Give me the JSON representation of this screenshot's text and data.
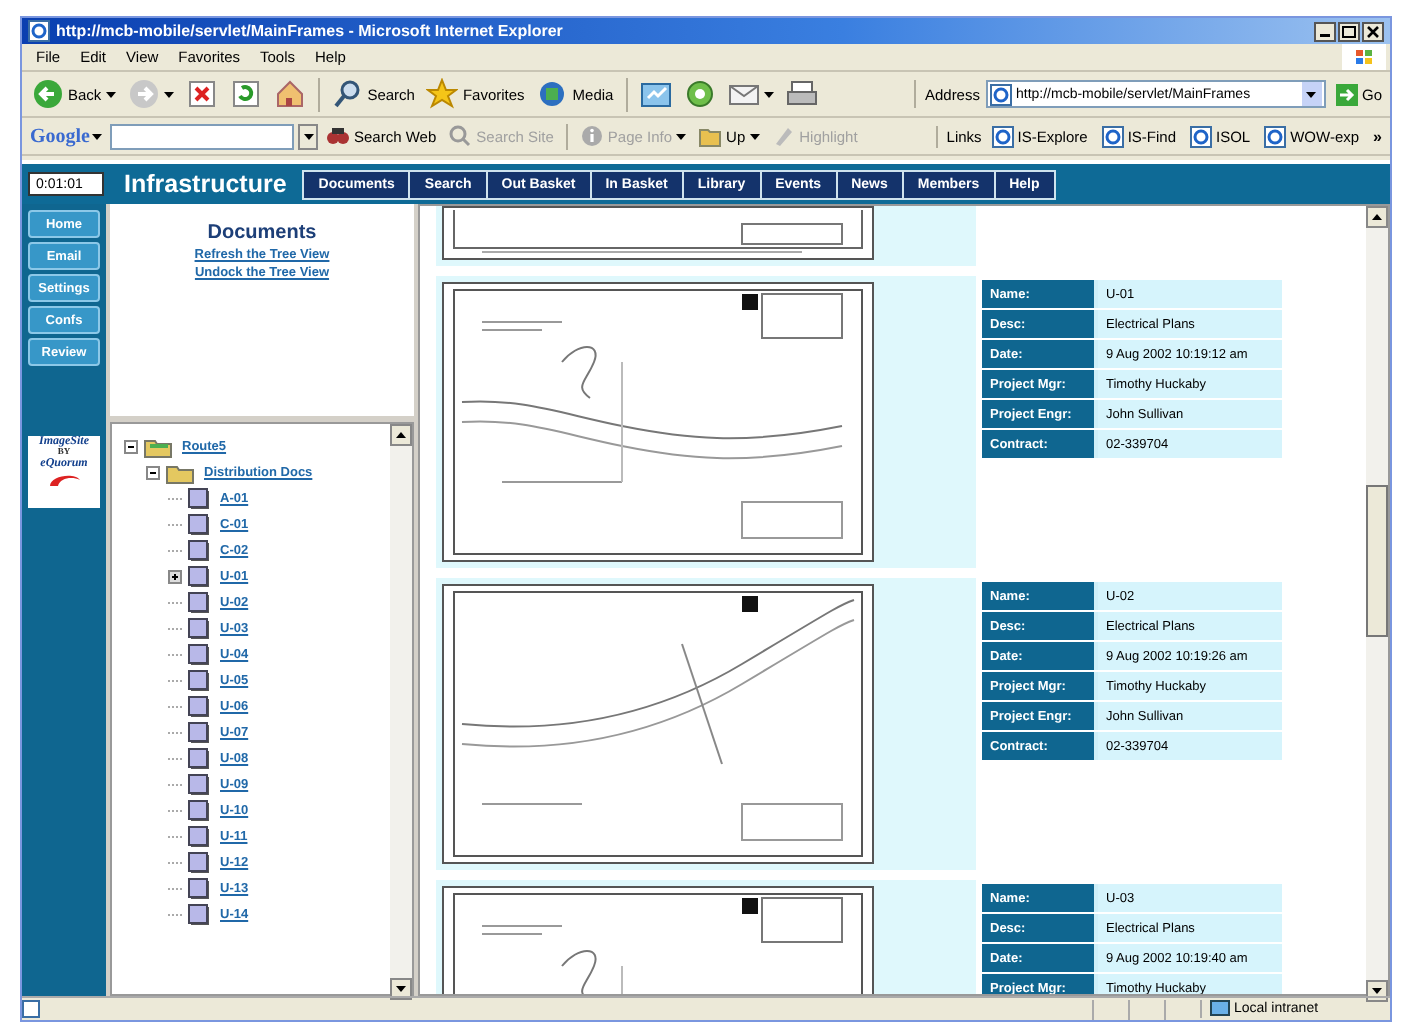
{
  "window": {
    "title": "http://mcb-mobile/servlet/MainFrames - Microsoft Internet Explorer"
  },
  "menu": [
    "File",
    "Edit",
    "View",
    "Favorites",
    "Tools",
    "Help"
  ],
  "toolbar": [
    {
      "kind": "back",
      "label": "Back"
    },
    {
      "kind": "forward"
    },
    {
      "kind": "stop"
    },
    {
      "kind": "refresh"
    },
    {
      "kind": "home"
    },
    {
      "kind": "search",
      "label": "Search"
    },
    {
      "kind": "favorites",
      "label": "Favorites"
    },
    {
      "kind": "media",
      "label": "Media"
    },
    {
      "kind": "history"
    },
    {
      "kind": "messenger"
    },
    {
      "kind": "mail"
    },
    {
      "kind": "print"
    }
  ],
  "address": {
    "label": "Address",
    "value": "http://mcb-mobile/servlet/MainFrames",
    "go": "Go"
  },
  "google_bar": {
    "logo": "Google",
    "items": [
      {
        "kind": "searchweb",
        "label": "Search Web",
        "disabled": false
      },
      {
        "kind": "searchsite",
        "label": "Search Site",
        "disabled": true
      },
      {
        "kind": "pageinfo",
        "label": "Page Info",
        "disabled": true
      },
      {
        "kind": "up",
        "label": "Up",
        "disabled": false
      },
      {
        "kind": "highlight",
        "label": "Highlight",
        "disabled": true
      }
    ]
  },
  "links": {
    "label": "Links",
    "items": [
      "IS-Explore",
      "IS-Find",
      "ISOL",
      "WOW-exp"
    ],
    "more": "»"
  },
  "site": {
    "timer": "0:01:01",
    "title": "Infrastructure",
    "tabs": [
      "Documents",
      "Search",
      "Out Basket",
      "In Basket",
      "Library",
      "Events",
      "News",
      "Members",
      "Help"
    ]
  },
  "side_nav": [
    "Home",
    "Email",
    "Settings",
    "Confs",
    "Review"
  ],
  "sponsor_logo": {
    "name": "ImageSite",
    "by": "BY",
    "company": "eQuorum"
  },
  "documents_panel": {
    "title": "Documents",
    "links": [
      "Refresh the Tree View",
      "Undock the Tree View"
    ]
  },
  "tree": [
    {
      "label": "Route5",
      "expanded": true,
      "children": [
        {
          "label": "Distribution Docs",
          "expanded": true,
          "children": [
            {
              "label": "A-01",
              "expandable": false
            },
            {
              "label": "C-01",
              "expandable": false
            },
            {
              "label": "C-02",
              "expandable": false
            },
            {
              "label": "U-01",
              "expandable": true
            },
            {
              "label": "U-02",
              "expandable": false
            },
            {
              "label": "U-03",
              "expandable": false
            },
            {
              "label": "U-04",
              "expandable": false
            },
            {
              "label": "U-05",
              "expandable": false
            },
            {
              "label": "U-06",
              "expandable": false
            },
            {
              "label": "U-07",
              "expandable": false
            },
            {
              "label": "U-08",
              "expandable": false
            },
            {
              "label": "U-09",
              "expandable": false
            },
            {
              "label": "U-10",
              "expandable": false
            },
            {
              "label": "U-11",
              "expandable": false
            },
            {
              "label": "U-12",
              "expandable": false
            },
            {
              "label": "U-13",
              "expandable": false
            },
            {
              "label": "U-14",
              "expandable": false
            }
          ]
        }
      ]
    }
  ],
  "documents": [
    {
      "fields": [
        {
          "label": "Name:",
          "value": "U-01"
        },
        {
          "label": "Desc:",
          "value": "Electrical Plans"
        },
        {
          "label": "Date:",
          "value": "9 Aug 2002 10:19:12 am"
        },
        {
          "label": "Project Mgr:",
          "value": "Timothy Huckaby"
        },
        {
          "label": "Project Engr:",
          "value": "John Sullivan"
        },
        {
          "label": "Contract:",
          "value": "02-339704"
        }
      ]
    },
    {
      "fields": [
        {
          "label": "Name:",
          "value": "U-02"
        },
        {
          "label": "Desc:",
          "value": "Electrical Plans"
        },
        {
          "label": "Date:",
          "value": "9 Aug 2002 10:19:26 am"
        },
        {
          "label": "Project Mgr:",
          "value": "Timothy Huckaby"
        },
        {
          "label": "Project Engr:",
          "value": "John Sullivan"
        },
        {
          "label": "Contract:",
          "value": "02-339704"
        }
      ]
    },
    {
      "fields": [
        {
          "label": "Name:",
          "value": "U-03"
        },
        {
          "label": "Desc:",
          "value": "Electrical Plans"
        },
        {
          "label": "Date:",
          "value": "9 Aug 2002 10:19:40 am"
        },
        {
          "label": "Project Mgr:",
          "value": "Timothy Huckaby"
        }
      ]
    }
  ],
  "status_bar": {
    "zone": "Local intranet"
  }
}
